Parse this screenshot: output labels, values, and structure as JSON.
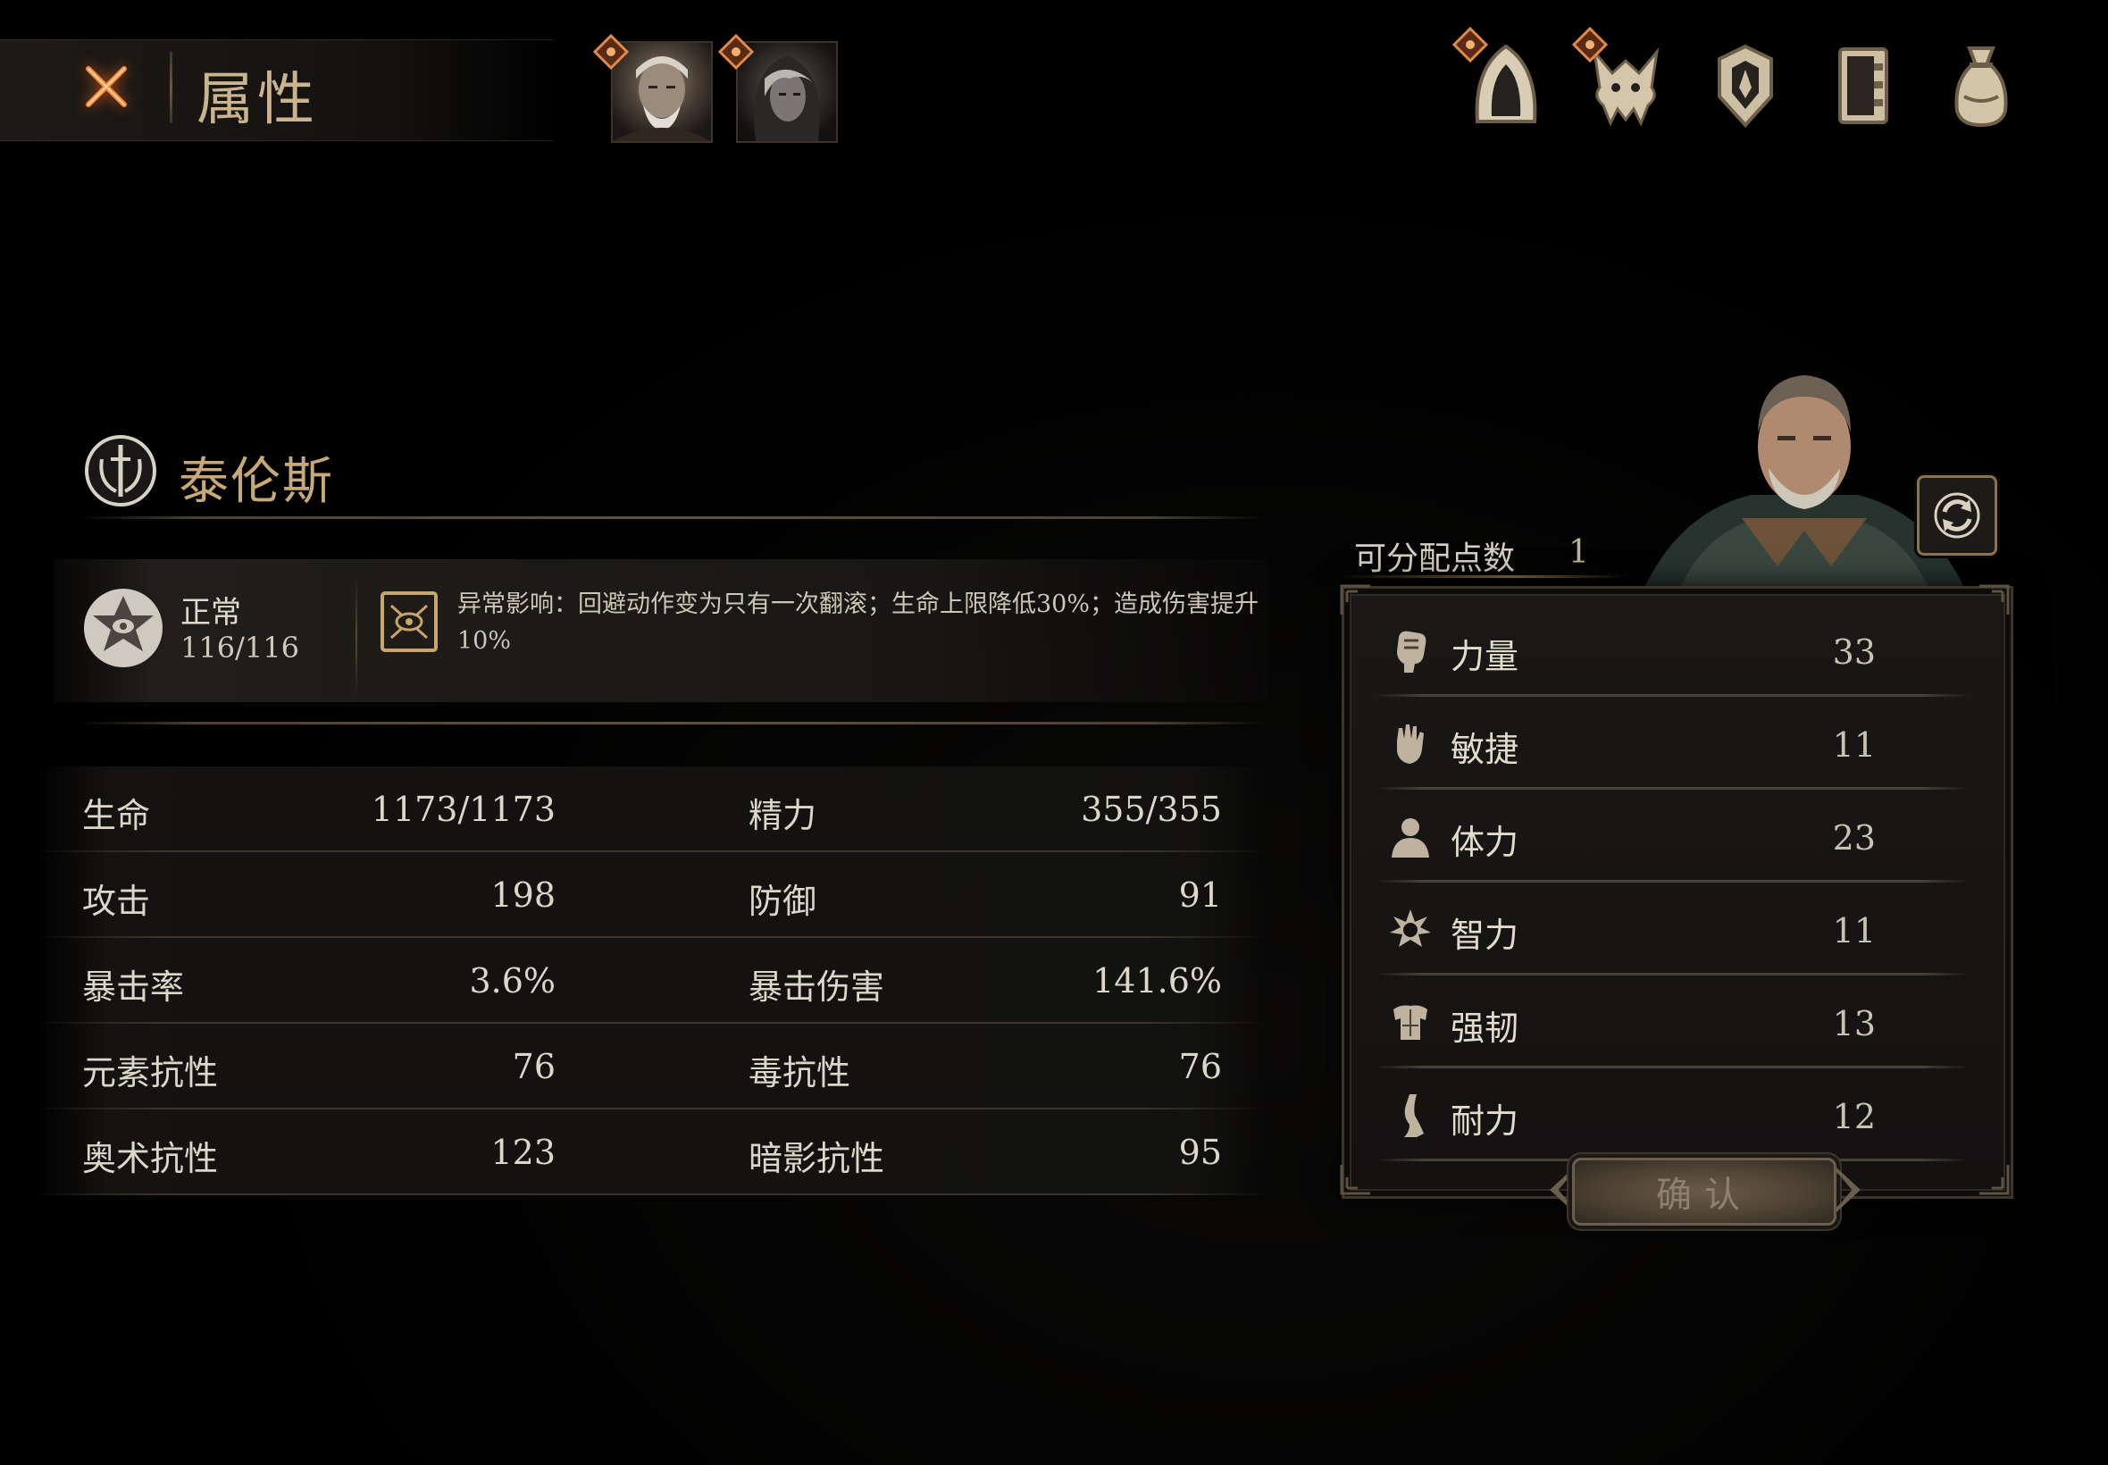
{
  "header": {
    "title": "属性",
    "close_icon": "close-x-icon",
    "party": [
      {
        "name_icon": "old-warrior-portrait",
        "badge": "diamond-eye-badge"
      },
      {
        "name_icon": "hooded-woman-portrait",
        "badge": "diamond-eye-badge"
      }
    ],
    "nav_icons": [
      "hood-armor-icon",
      "beast-skull-icon",
      "shield-crest-icon",
      "journal-book-icon",
      "loot-sack-icon"
    ]
  },
  "character": {
    "name": "泰伦斯",
    "class_icon": "sword-wreath-emblem-icon"
  },
  "status": {
    "name": "正常",
    "value": "116/116",
    "effect_label": "异常影响：回避动作变为只有一次翻滚；生命上限降低30%；造成伤害提升10%"
  },
  "stats": [
    {
      "left_label": "生命",
      "left_value": "1173/1173",
      "right_label": "精力",
      "right_value": "355/355"
    },
    {
      "left_label": "攻击",
      "left_value": "198",
      "right_label": "防御",
      "right_value": "91"
    },
    {
      "left_label": "暴击率",
      "left_value": "3.6%",
      "right_label": "暴击伤害",
      "right_value": "141.6%"
    },
    {
      "left_label": "元素抗性",
      "left_value": "76",
      "right_label": "毒抗性",
      "right_value": "76"
    },
    {
      "left_label": "奥术抗性",
      "left_value": "123",
      "right_label": "暗影抗性",
      "right_value": "95"
    }
  ],
  "allocation": {
    "label": "可分配点数",
    "value": "1"
  },
  "attributes": [
    {
      "name": "力量",
      "value": "33",
      "icon": "fist-icon"
    },
    {
      "name": "敏捷",
      "value": "11",
      "icon": "hand-icon"
    },
    {
      "name": "体力",
      "value": "23",
      "icon": "bust-icon"
    },
    {
      "name": "智力",
      "value": "11",
      "icon": "spark-head-icon"
    },
    {
      "name": "强韧",
      "value": "13",
      "icon": "torso-icon"
    },
    {
      "name": "耐力",
      "value": "12",
      "icon": "leg-icon"
    }
  ],
  "confirm_label": "确认",
  "colors": {
    "accent_gold": "#c7a978",
    "close_orange": "#ff7a2a",
    "text": "#ddd7ca"
  }
}
